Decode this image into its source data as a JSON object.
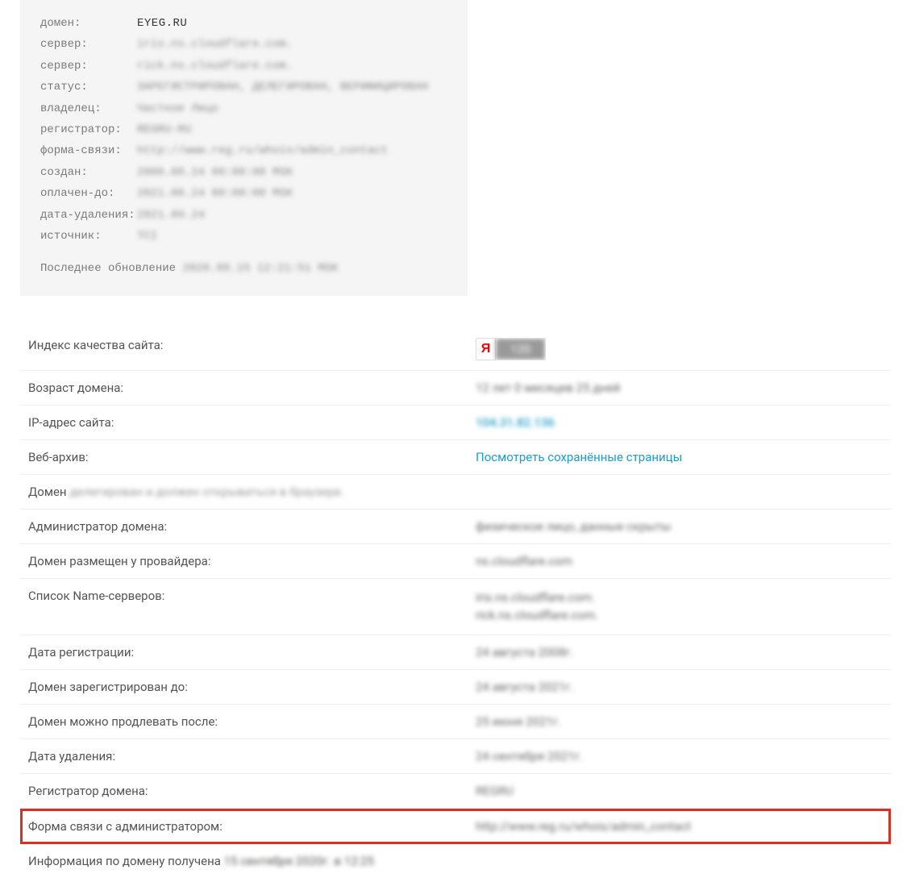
{
  "whois": {
    "rows": [
      {
        "label": "домен:",
        "value": "EYEG.RU",
        "clear": true,
        "blurValue": false
      },
      {
        "label": "сервер:",
        "value": "iris.ns.cloudflare.com.",
        "clear": false,
        "blurValue": true
      },
      {
        "label": "сервер:",
        "value": "rick.ns.cloudflare.com.",
        "clear": false,
        "blurValue": true
      },
      {
        "label": "статус:",
        "value": "ЗАРЕГИСТРИРОВАН, ДЕЛЕГИРОВАН, ВЕРИФИЦИРОВАН",
        "clear": false,
        "blurValue": true
      },
      {
        "label": "владелец:",
        "value": "Частное Лицо",
        "clear": false,
        "blurValue": true
      },
      {
        "label": "регистратор:",
        "value": "REGRU-RU",
        "clear": false,
        "blurValue": true
      },
      {
        "label": "форма-связи:",
        "value": "http://www.reg.ru/whois/admin_contact",
        "clear": false,
        "blurValue": true
      },
      {
        "label": "создан:",
        "value": "2008.08.24 00:00:00 MSK",
        "clear": false,
        "blurValue": true
      },
      {
        "label": "оплачен-до:",
        "value": "2021.08.24 00:00:00 MSK",
        "clear": false,
        "blurValue": true
      },
      {
        "label": "дата-удаления:",
        "value": "2021.09.24",
        "clear": false,
        "blurValue": true
      },
      {
        "label": "источник:",
        "value": "TCI",
        "clear": false,
        "blurValue": true
      }
    ],
    "footer_label": "Последнее обновление",
    "footer_date": "2020.09.15 12:21:51 MSK"
  },
  "info": {
    "quality_index": {
      "label": "Индекс качества сайта:",
      "badge_letter": "Я",
      "badge_score": "120"
    },
    "domain_age": {
      "label": "Возраст домена:",
      "value": "12 лет 0 месяцев 25 дней"
    },
    "ip_address": {
      "label": "IP-адрес сайта:",
      "value": "104.31.82.136"
    },
    "web_archive": {
      "label": "Веб-архив:",
      "value": "Посмотреть сохранённые страницы"
    },
    "domain_status": {
      "prefix": "Домен",
      "status": "делегирован и должен открываться в браузере."
    },
    "admin": {
      "label": "Администратор домена:",
      "value": "физическое лицо, данные скрыты"
    },
    "provider": {
      "label": "Домен размещен у провайдера:",
      "value": "ns.cloudflare.com"
    },
    "nameservers": {
      "label": "Список Name-серверов:",
      "value1": "iris.ns.cloudflare.com.",
      "value2": "rick.ns.cloudflare.com."
    },
    "reg_date": {
      "label": "Дата регистрации:",
      "value": "24 августа 2008г."
    },
    "reg_until": {
      "label": "Домен зарегистрирован до:",
      "value": "24 августа 2021г."
    },
    "renewal_after": {
      "label": "Домен можно продлевать после:",
      "value": "25 июня 2021г."
    },
    "delete_date": {
      "label": "Дата удаления:",
      "value": "24 сентября 2021г."
    },
    "registrar": {
      "label": "Регистратор домена:",
      "value": "REGRU"
    },
    "contact_form": {
      "label": "Форма связи с администратором:",
      "value": "http://www.reg.ru/whois/admin_contact"
    },
    "retrieved": {
      "prefix": "Информация по домену получена",
      "date": "15 сентября 2020г. в 12:25"
    }
  }
}
